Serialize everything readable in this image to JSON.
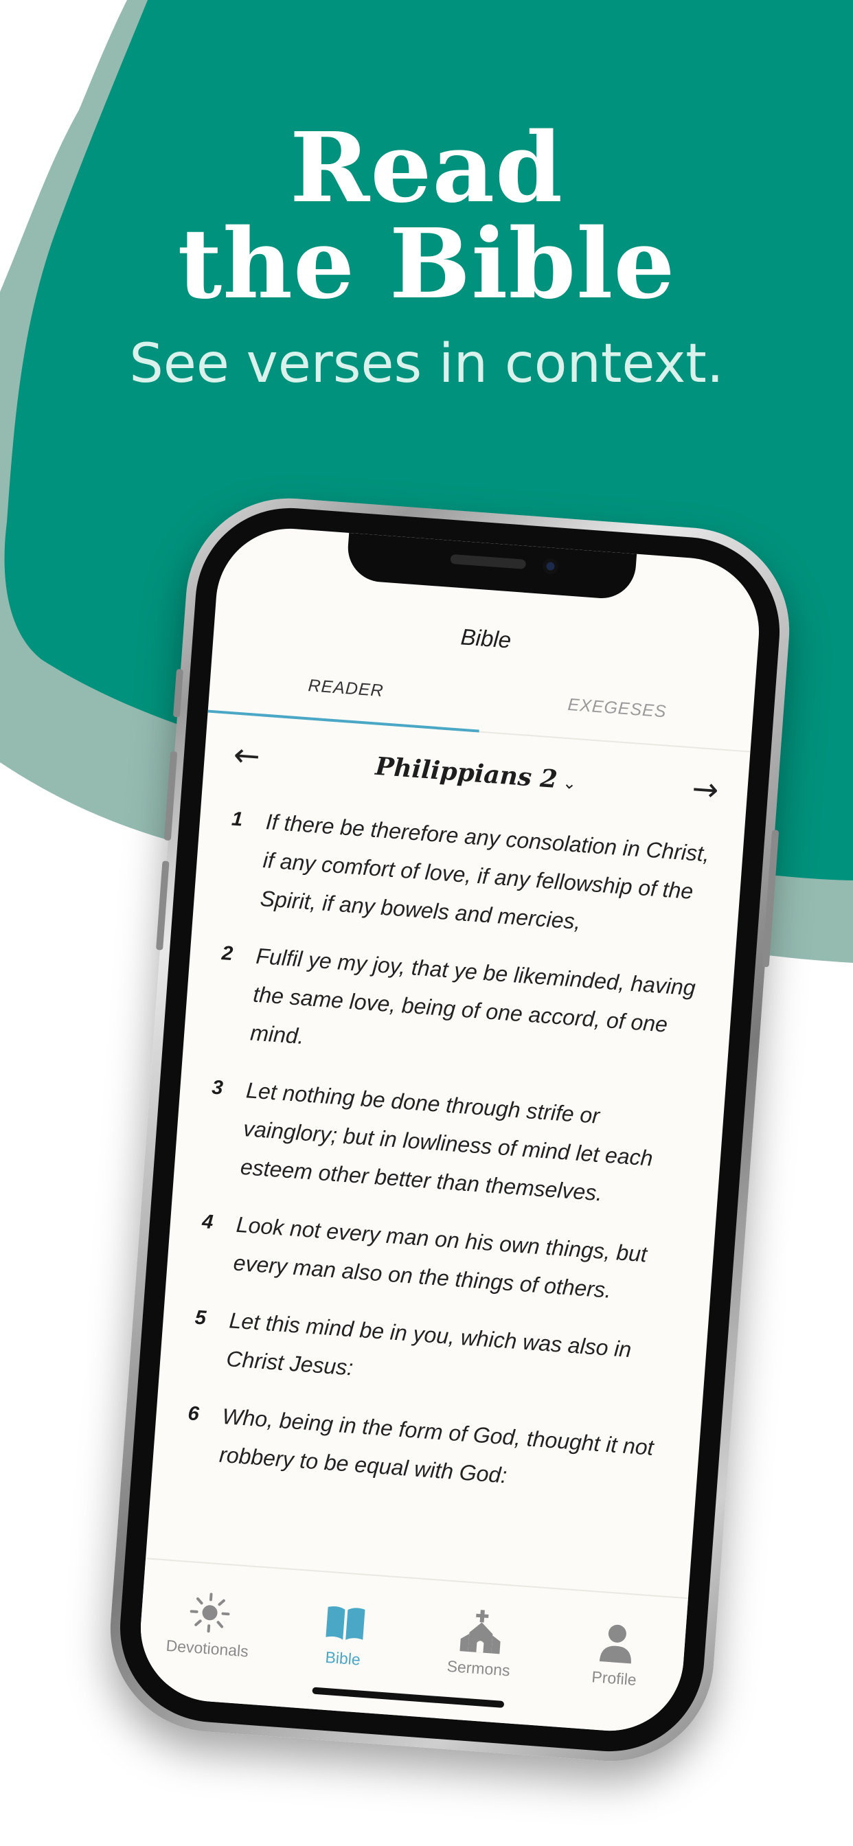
{
  "colors": {
    "brand_teal": "#00927c",
    "teal_shadow": "#95bbb1",
    "accent_blue": "#4aa8c6",
    "screen_bg": "#fcfbf8"
  },
  "hero": {
    "title_line1": "Read",
    "title_line2": "the Bible",
    "subtitle": "See verses in context."
  },
  "app": {
    "screen_title": "Bible",
    "tabs": [
      {
        "label": "READER",
        "active": true
      },
      {
        "label": "EXEGESES",
        "active": false
      }
    ],
    "nav": {
      "prev_icon": "arrow-left-icon",
      "next_icon": "arrow-right-icon",
      "book": "Philippians 2",
      "dropdown_icon": "chevron-down-icon"
    },
    "verses": [
      {
        "num": "1",
        "text": "If there be therefore any consolation in Christ, if any comfort of love, if any fellowship of the Spirit, if any bowels and mercies,"
      },
      {
        "num": "2",
        "text": "Fulfil ye my joy, that ye be likeminded, having the same love, being of one accord, of one mind."
      },
      {
        "num": "3",
        "text": "Let nothing be done through strife or vainglory; but in lowliness of mind let each esteem other better than themselves."
      },
      {
        "num": "4",
        "text": "Look not every man on his own things, but every man also on the things of others."
      },
      {
        "num": "5",
        "text": "Let this mind be in you, which was also in Christ Jesus:"
      },
      {
        "num": "6",
        "text": "Who, being in the form of God, thought it not robbery to be equal with God:"
      }
    ],
    "tabbar": [
      {
        "label": "Devotionals",
        "icon": "sun-icon",
        "active": false
      },
      {
        "label": "Bible",
        "icon": "book-icon",
        "active": true
      },
      {
        "label": "Sermons",
        "icon": "church-icon",
        "active": false
      },
      {
        "label": "Profile",
        "icon": "person-icon",
        "active": false
      }
    ]
  }
}
